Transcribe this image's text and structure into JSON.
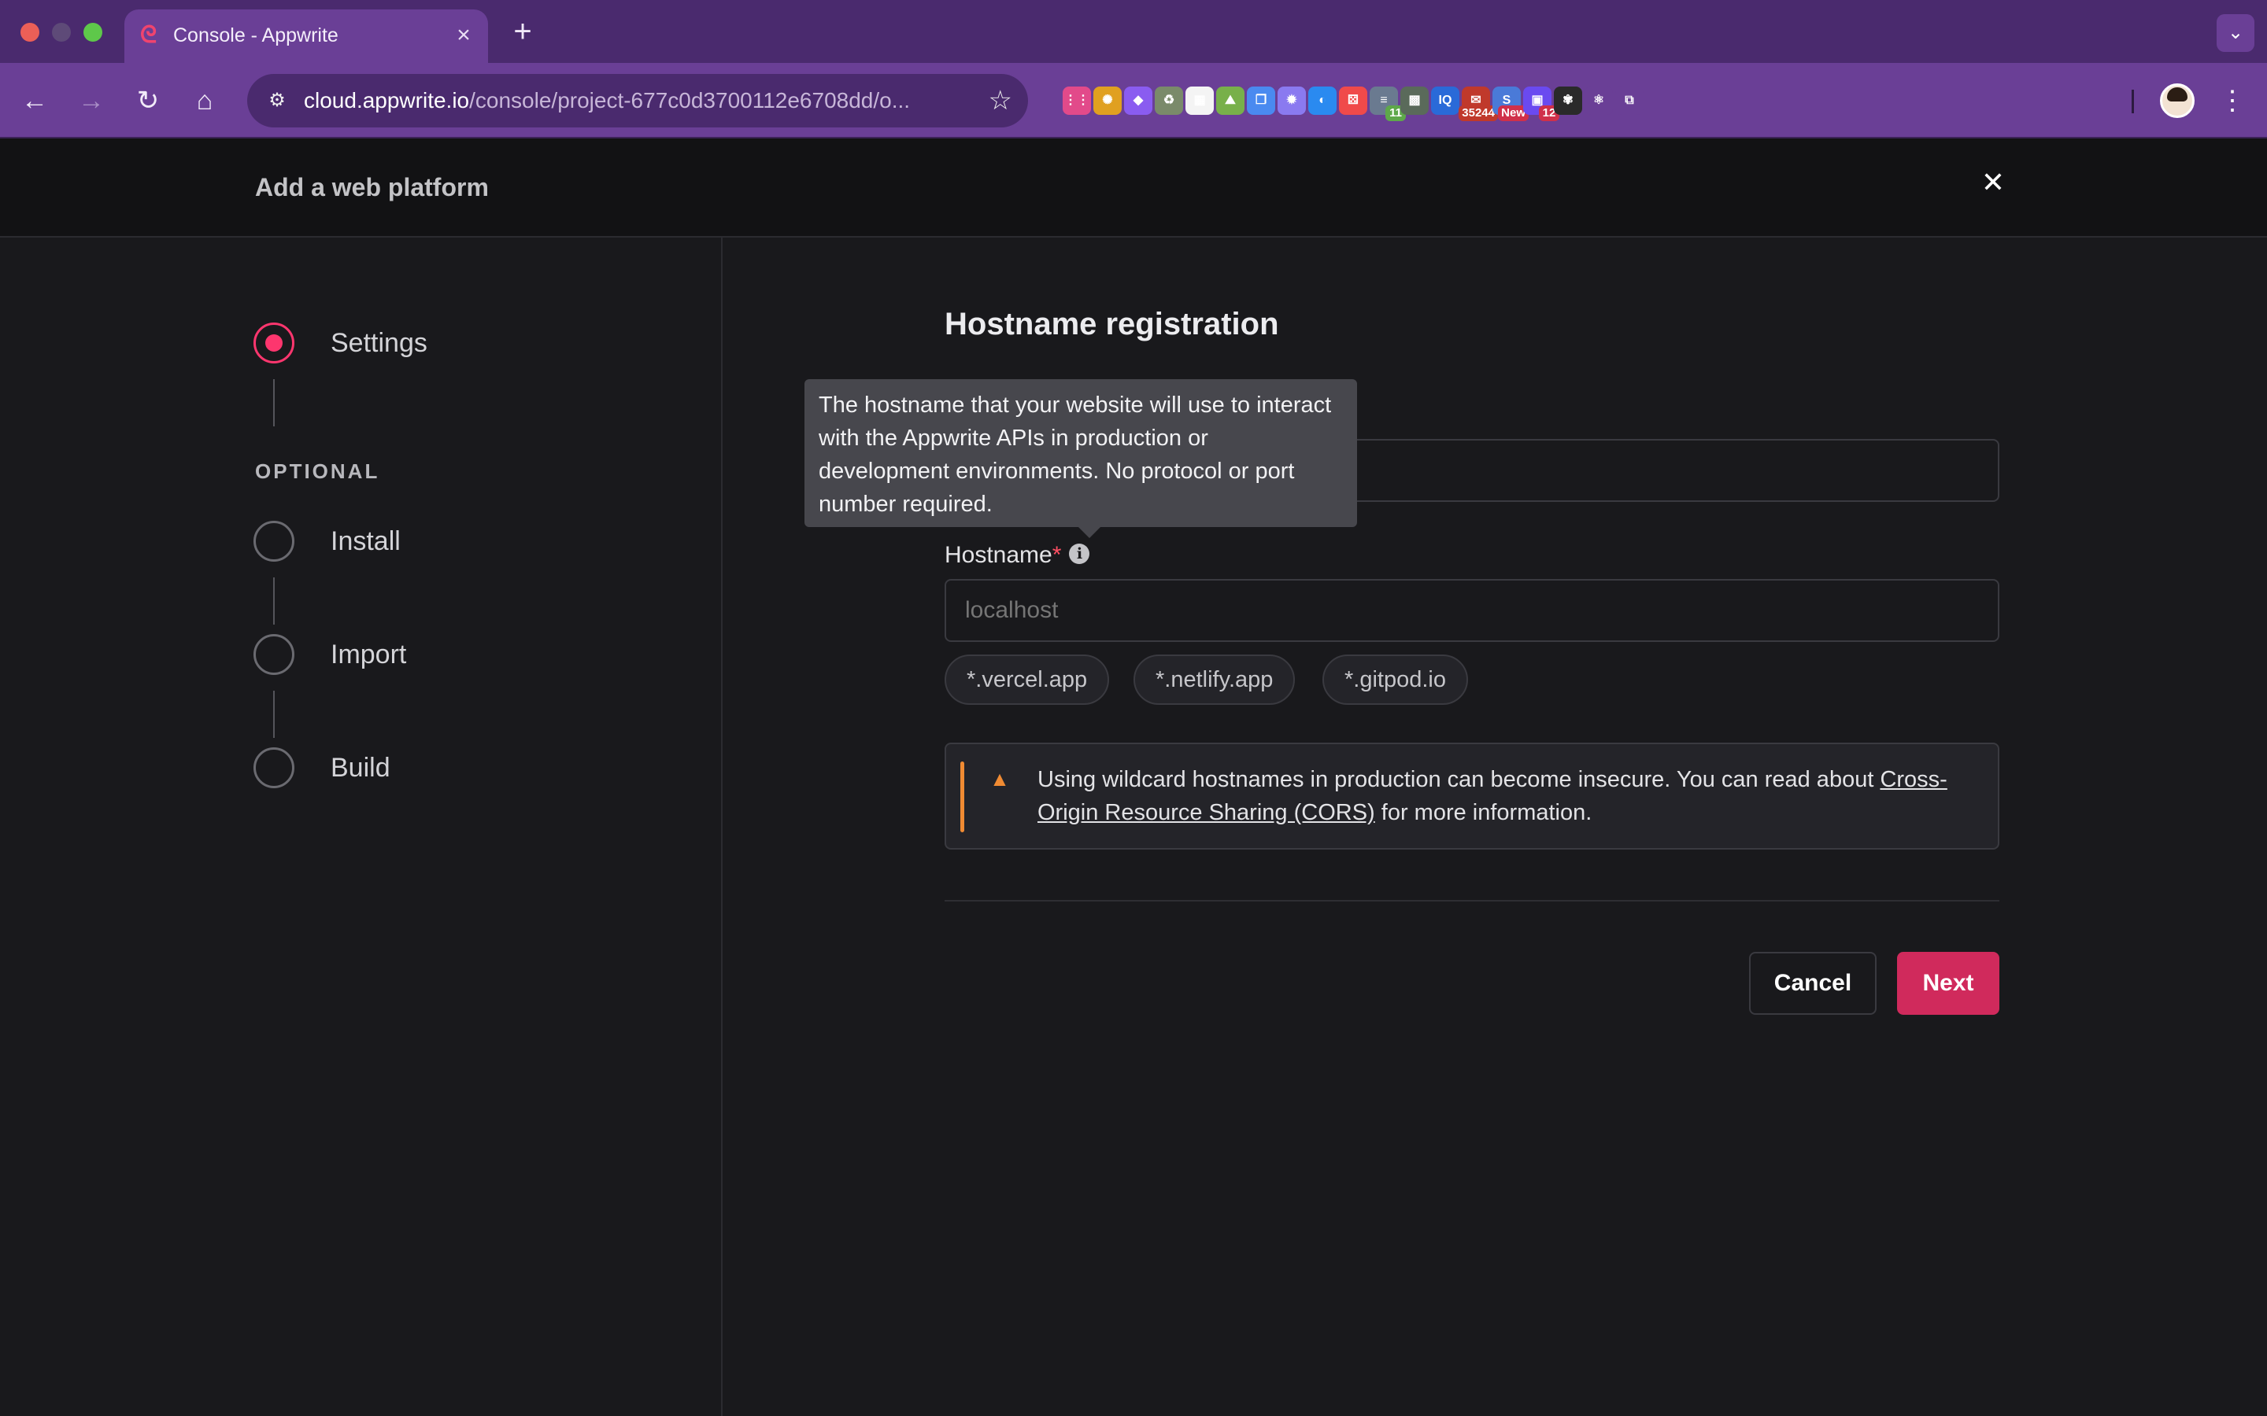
{
  "browser": {
    "tab_title": "Console - Appwrite",
    "tab_close": "×",
    "new_tab": "+",
    "tab_search": "⌄",
    "url_domain": "cloud.appwrite.io",
    "url_path": "/console/project-677c0d3700112e6708dd/o...",
    "extensions": [
      {
        "name": "apps-grid-icon",
        "glyph": "⋮⋮",
        "color": "#e24a8a"
      },
      {
        "name": "color-wheel-extension-icon",
        "glyph": "✺",
        "color": "#e0a020"
      },
      {
        "name": "paint-extension-icon",
        "glyph": "◆",
        "color": "#8a5cf0"
      },
      {
        "name": "recycle-extension-icon",
        "glyph": "♻",
        "color": "#7a8a6a"
      },
      {
        "name": "calendar-extension-icon",
        "glyph": "▦",
        "color": "#f4f4f4"
      },
      {
        "name": "landscape-extension-icon",
        "glyph": "⛰",
        "color": "#78b04a"
      },
      {
        "name": "copy-extension-icon",
        "glyph": "❐",
        "color": "#4a8af0"
      },
      {
        "name": "settings-extension-icon",
        "glyph": "✹",
        "color": "#8a7af0"
      },
      {
        "name": "swirl-extension-icon",
        "glyph": "◐",
        "color": "#2a8af0"
      },
      {
        "name": "dice-extension-icon",
        "glyph": "⚄",
        "color": "#f04a4a"
      },
      {
        "name": "list-extension-icon",
        "glyph": "≡",
        "color": "#6a7a90",
        "badge": "11",
        "badge_color": "#5ea84a"
      },
      {
        "name": "grid-extension-icon",
        "glyph": "▩",
        "color": "#5a6a5a"
      },
      {
        "name": "iq-extension-icon",
        "glyph": "IQ",
        "color": "#2a6ad8"
      },
      {
        "name": "mail-extension-icon",
        "glyph": "✉",
        "color": "#c0392b",
        "badge": "35244",
        "badge_color": "#c0392b"
      },
      {
        "name": "new-extension-icon",
        "glyph": "S",
        "color": "#4a7ad8",
        "badge": "New",
        "badge_color": "#d0304a"
      },
      {
        "name": "chat-extension-icon",
        "glyph": "▣",
        "color": "#6a4af0",
        "badge": "12",
        "badge_color": "#d0304a"
      },
      {
        "name": "chatgpt-extension-icon",
        "glyph": "✾",
        "color": "#2a2a2a"
      },
      {
        "name": "react-extension-icon",
        "glyph": "⚛",
        "color": "#6a3f96"
      },
      {
        "name": "puzzle-extension-icon",
        "glyph": "⧉",
        "color": "#6a3f96"
      }
    ]
  },
  "modal": {
    "title": "Add a web platform",
    "close": "✕"
  },
  "steps": {
    "settings": "Settings",
    "optional": "OPTIONAL",
    "install": "Install",
    "import": "Import",
    "build": "Build"
  },
  "form": {
    "section_title": "Hostname registration",
    "hostname_label": "Hostname",
    "required_mark": "*",
    "hostname_placeholder": "localhost",
    "chips": [
      "*.vercel.app",
      "*.netlify.app",
      "*.gitpod.io"
    ],
    "tooltip": "The hostname that your website will use to interact with the Appwrite APIs in production or development environments. No protocol or port number required.",
    "alert_prefix": "Using wildcard hostnames in production can become insecure. You can read about ",
    "alert_link": "Cross-Origin Resource Sharing (CORS)",
    "alert_suffix": " for more information.",
    "cancel": "Cancel",
    "next": "Next"
  },
  "colors": {
    "accent": "#fd366e",
    "primary_button": "#d02a5c",
    "warning": "#f08b33",
    "chrome": "#6a3f96"
  }
}
